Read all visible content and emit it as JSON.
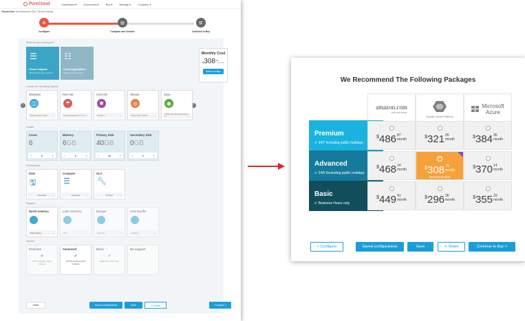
{
  "header": {
    "brand": "PureCloud",
    "nav": [
      "Dashboard ▾",
      "Documents ▾",
      "Buy ▾",
      "Manage ▾",
      "Company ▾"
    ]
  },
  "breadcrumb": {
    "you_are_here": "You are here:",
    "path": "My Dashboard / Buy / Service Catalog"
  },
  "steps": [
    "Configure",
    "Compare and Choose",
    "Continue to Buy"
  ],
  "config": {
    "purpose_heading": "What are you looking for?",
    "purposes": [
      {
        "title": "Cloud Compute",
        "sub": "Infrastructure as a Service"
      },
      {
        "title": "Cloud Applications",
        "sub": "Software as a Service"
      }
    ],
    "monthly": {
      "title": "Monthly Cost",
      "currency": "$",
      "amount": "308",
      "cents": "79",
      "unit": "/month",
      "button": "Saved configs"
    },
    "os_heading": "Choose an Operating System",
    "os": [
      {
        "name": "Windows",
        "select": "Windows Server 2016"
      },
      {
        "name": "Red Hat",
        "select": "Red Hat Enterprise 7.3 v1.3"
      },
      {
        "name": "Cent OS",
        "select": "CentOS 7"
      },
      {
        "name": "Ubuntu",
        "select": "Ubuntu Server 16.04"
      },
      {
        "name": "Suse",
        "select": "SUSE Linux Enterprise Server 11"
      }
    ],
    "details_heading": "Details",
    "details": [
      {
        "name": "Cores",
        "value": "6",
        "unit": "",
        "step": "6"
      },
      {
        "name": "Memory",
        "value": "6",
        "unit": "GB",
        "step": "6"
      },
      {
        "name": "Primary Disk",
        "value": "40",
        "unit": "GB",
        "step": "40"
      },
      {
        "name": "Secondary Disk",
        "value": "0",
        "unit": "GB",
        "step": "0"
      }
    ],
    "perf_heading": "Performance",
    "perf": [
      {
        "name": "Disk",
        "select": "Increased"
      },
      {
        "name": "Compute",
        "select": "Increased"
      },
      {
        "name": "SLA",
        "select": "No SLA"
      }
    ],
    "regions_heading": "Regions",
    "regions": [
      {
        "name": "North America",
        "select": "United States"
      },
      {
        "name": "Latin America",
        "select": "N/A"
      },
      {
        "name": "Europe",
        "select": "Germany"
      },
      {
        "name": "Asia Pacific",
        "select": "Australia"
      }
    ],
    "service_heading": "Service",
    "services": [
      {
        "name": "Premium",
        "desc": "24/7 including public holidays"
      },
      {
        "name": "Advanced",
        "desc": "24/5 Excluding public holidays"
      },
      {
        "name": "Basic",
        "desc": "Business Hours only"
      },
      {
        "name": "No support",
        "desc": ""
      }
    ],
    "buttons": {
      "clear": "Clear",
      "saved": "Saved configurations",
      "save": "Save",
      "share": "≺ Share",
      "compare": "Compare >"
    }
  },
  "recommend": {
    "title": "We Recommend The Following Packages",
    "vendors": [
      {
        "name": "amazon.com",
        "sub": "web services"
      },
      {
        "name": "Google Cloud Platform",
        "sub": ""
      },
      {
        "name": "Microsoft",
        "sub": "Azure"
      }
    ],
    "rows": [
      {
        "name": "Premium",
        "desc": "✔ 24/7 including public holidays",
        "prices": [
          {
            "a": "486",
            "c": "87"
          },
          {
            "a": "321",
            "c": "05"
          },
          {
            "a": "384",
            "c": "95"
          }
        ]
      },
      {
        "name": "Advanced",
        "desc": "✔ 24/5 Excluding public holidays",
        "prices": [
          {
            "a": "468",
            "c": "14"
          },
          {
            "a": "308",
            "c": "79"
          },
          {
            "a": "370",
            "c": "14"
          }
        ]
      },
      {
        "name": "Basic",
        "desc": "✔ Business Hours only",
        "prices": [
          {
            "a": "449",
            "c": "41"
          },
          {
            "a": "296",
            "c": "36"
          },
          {
            "a": "355",
            "c": "33"
          }
        ]
      }
    ],
    "currency": "$",
    "per": "month",
    "recommended_label": "Recommended",
    "buttons": {
      "configure": "< Configure",
      "saved": "Saved configurations",
      "save": "Save",
      "share": "≺ Share",
      "continue": "Continue to Buy >"
    }
  },
  "colors": {
    "premium": "#1ab3e0",
    "advanced": "#157a9b",
    "basic": "#124d5c",
    "accent": "#1a9ed9",
    "recommended": "#f6a23c",
    "arrow": "#d9262c"
  }
}
